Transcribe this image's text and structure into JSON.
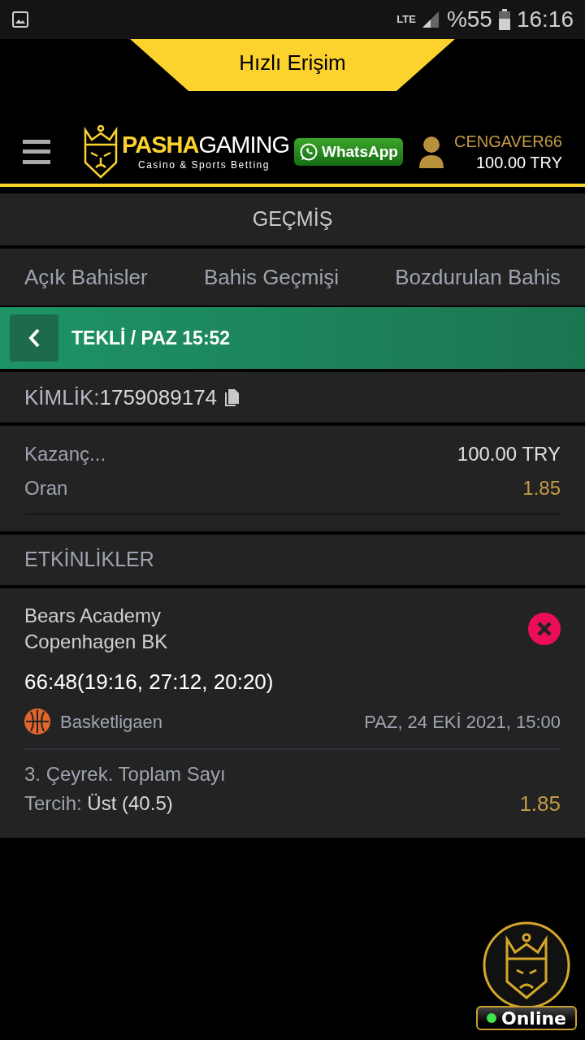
{
  "status_bar": {
    "network": "LTE",
    "battery": "%55",
    "time": "16:16"
  },
  "quick_access": {
    "label": "Hızlı Erişim"
  },
  "header": {
    "brand_bold": "PASHA",
    "brand_light": "GAMING",
    "tagline": "Casino & Sports Betting",
    "whatsapp": "WhatsApp",
    "username": "CENGAVER66",
    "balance": "100.00 TRY"
  },
  "page_title": "GEÇMİŞ",
  "tabs": [
    {
      "label": "Açık Bahisler",
      "selected": false
    },
    {
      "label": "Bahis Geçmişi",
      "selected": false
    },
    {
      "label": "Bozdurulan Bahis",
      "selected": false
    }
  ],
  "bet_header": {
    "title": "TEKLİ / PAZ 15:52"
  },
  "bet_id": {
    "label": "KİMLİK:",
    "value": "1759089174"
  },
  "summary": [
    {
      "kind": "amount",
      "label": "Kazanç...",
      "value": "100.00 TRY"
    },
    {
      "kind": "odds",
      "label": "Oran",
      "value": "1.85"
    }
  ],
  "events_title": "ETKİNLİKLER",
  "events": [
    {
      "kind": "lost",
      "teams": [
        "Bears Academy",
        "Copenhagen BK"
      ],
      "score": "66:48(19:16, 27:12, 20:20)",
      "league": "Basketligaen",
      "date": "PAZ, 24 EKİ 2021, 15:00",
      "market": "3. Çeyrek. Toplam Sayı",
      "choice_label": "Tercih:",
      "choice": "Üst (40.5)",
      "odds": "1.85"
    }
  ],
  "chat": {
    "label": "Online",
    "online": true
  }
}
